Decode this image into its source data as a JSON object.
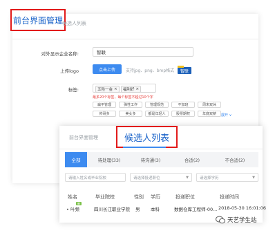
{
  "back_panel": {
    "active_tab": "前台界面管理",
    "inactive_tab": "候选人列表",
    "company_name_label": "对外显示企业名称:",
    "company_name_value": "智联",
    "logo_label": "上传logo",
    "upload_button": "点击上传",
    "upload_hint": "支持jpg、png、bmp格式",
    "logo_text": "智联",
    "tags_label": "标签:",
    "selected_tags": [
      "五险一金",
      "福利好"
    ],
    "tags_hint": "最多20个标签，每个标签不超过10个字",
    "tag_options_row1": [
      "扁平管理",
      "弹性工作",
      "管理规范",
      "不加班",
      "周末双休"
    ],
    "tag_options_row2": [
      "帅哥多",
      "美女多",
      "都是年轻人",
      "股票期权",
      "年底双薪"
    ],
    "expand_link": "展开 ∨"
  },
  "front_panel": {
    "inactive_tab": "前台界面管理",
    "active_tab": "候选人列表",
    "status_tabs": [
      "全部",
      "待处理(33)",
      "待沟通(3)",
      "合适(2)",
      "不合适(2)"
    ],
    "filters": {
      "name_placeholder": "请输入姓名或毕业院校",
      "position_placeholder": "请选择投递职位",
      "edu_placeholder": "请选择学历"
    },
    "table_headers": [
      "姓名",
      "毕业院校",
      "性别",
      "学历",
      "投递职位",
      "投递时间"
    ],
    "row": {
      "badge": "新",
      "name": "叶频",
      "school": "四川长江职业学院",
      "gender": "男",
      "education": "本科",
      "position": "数据仓库工程师-00...",
      "time": "2018-05-30 16:01:06"
    }
  },
  "watermark": "天艺学生站"
}
